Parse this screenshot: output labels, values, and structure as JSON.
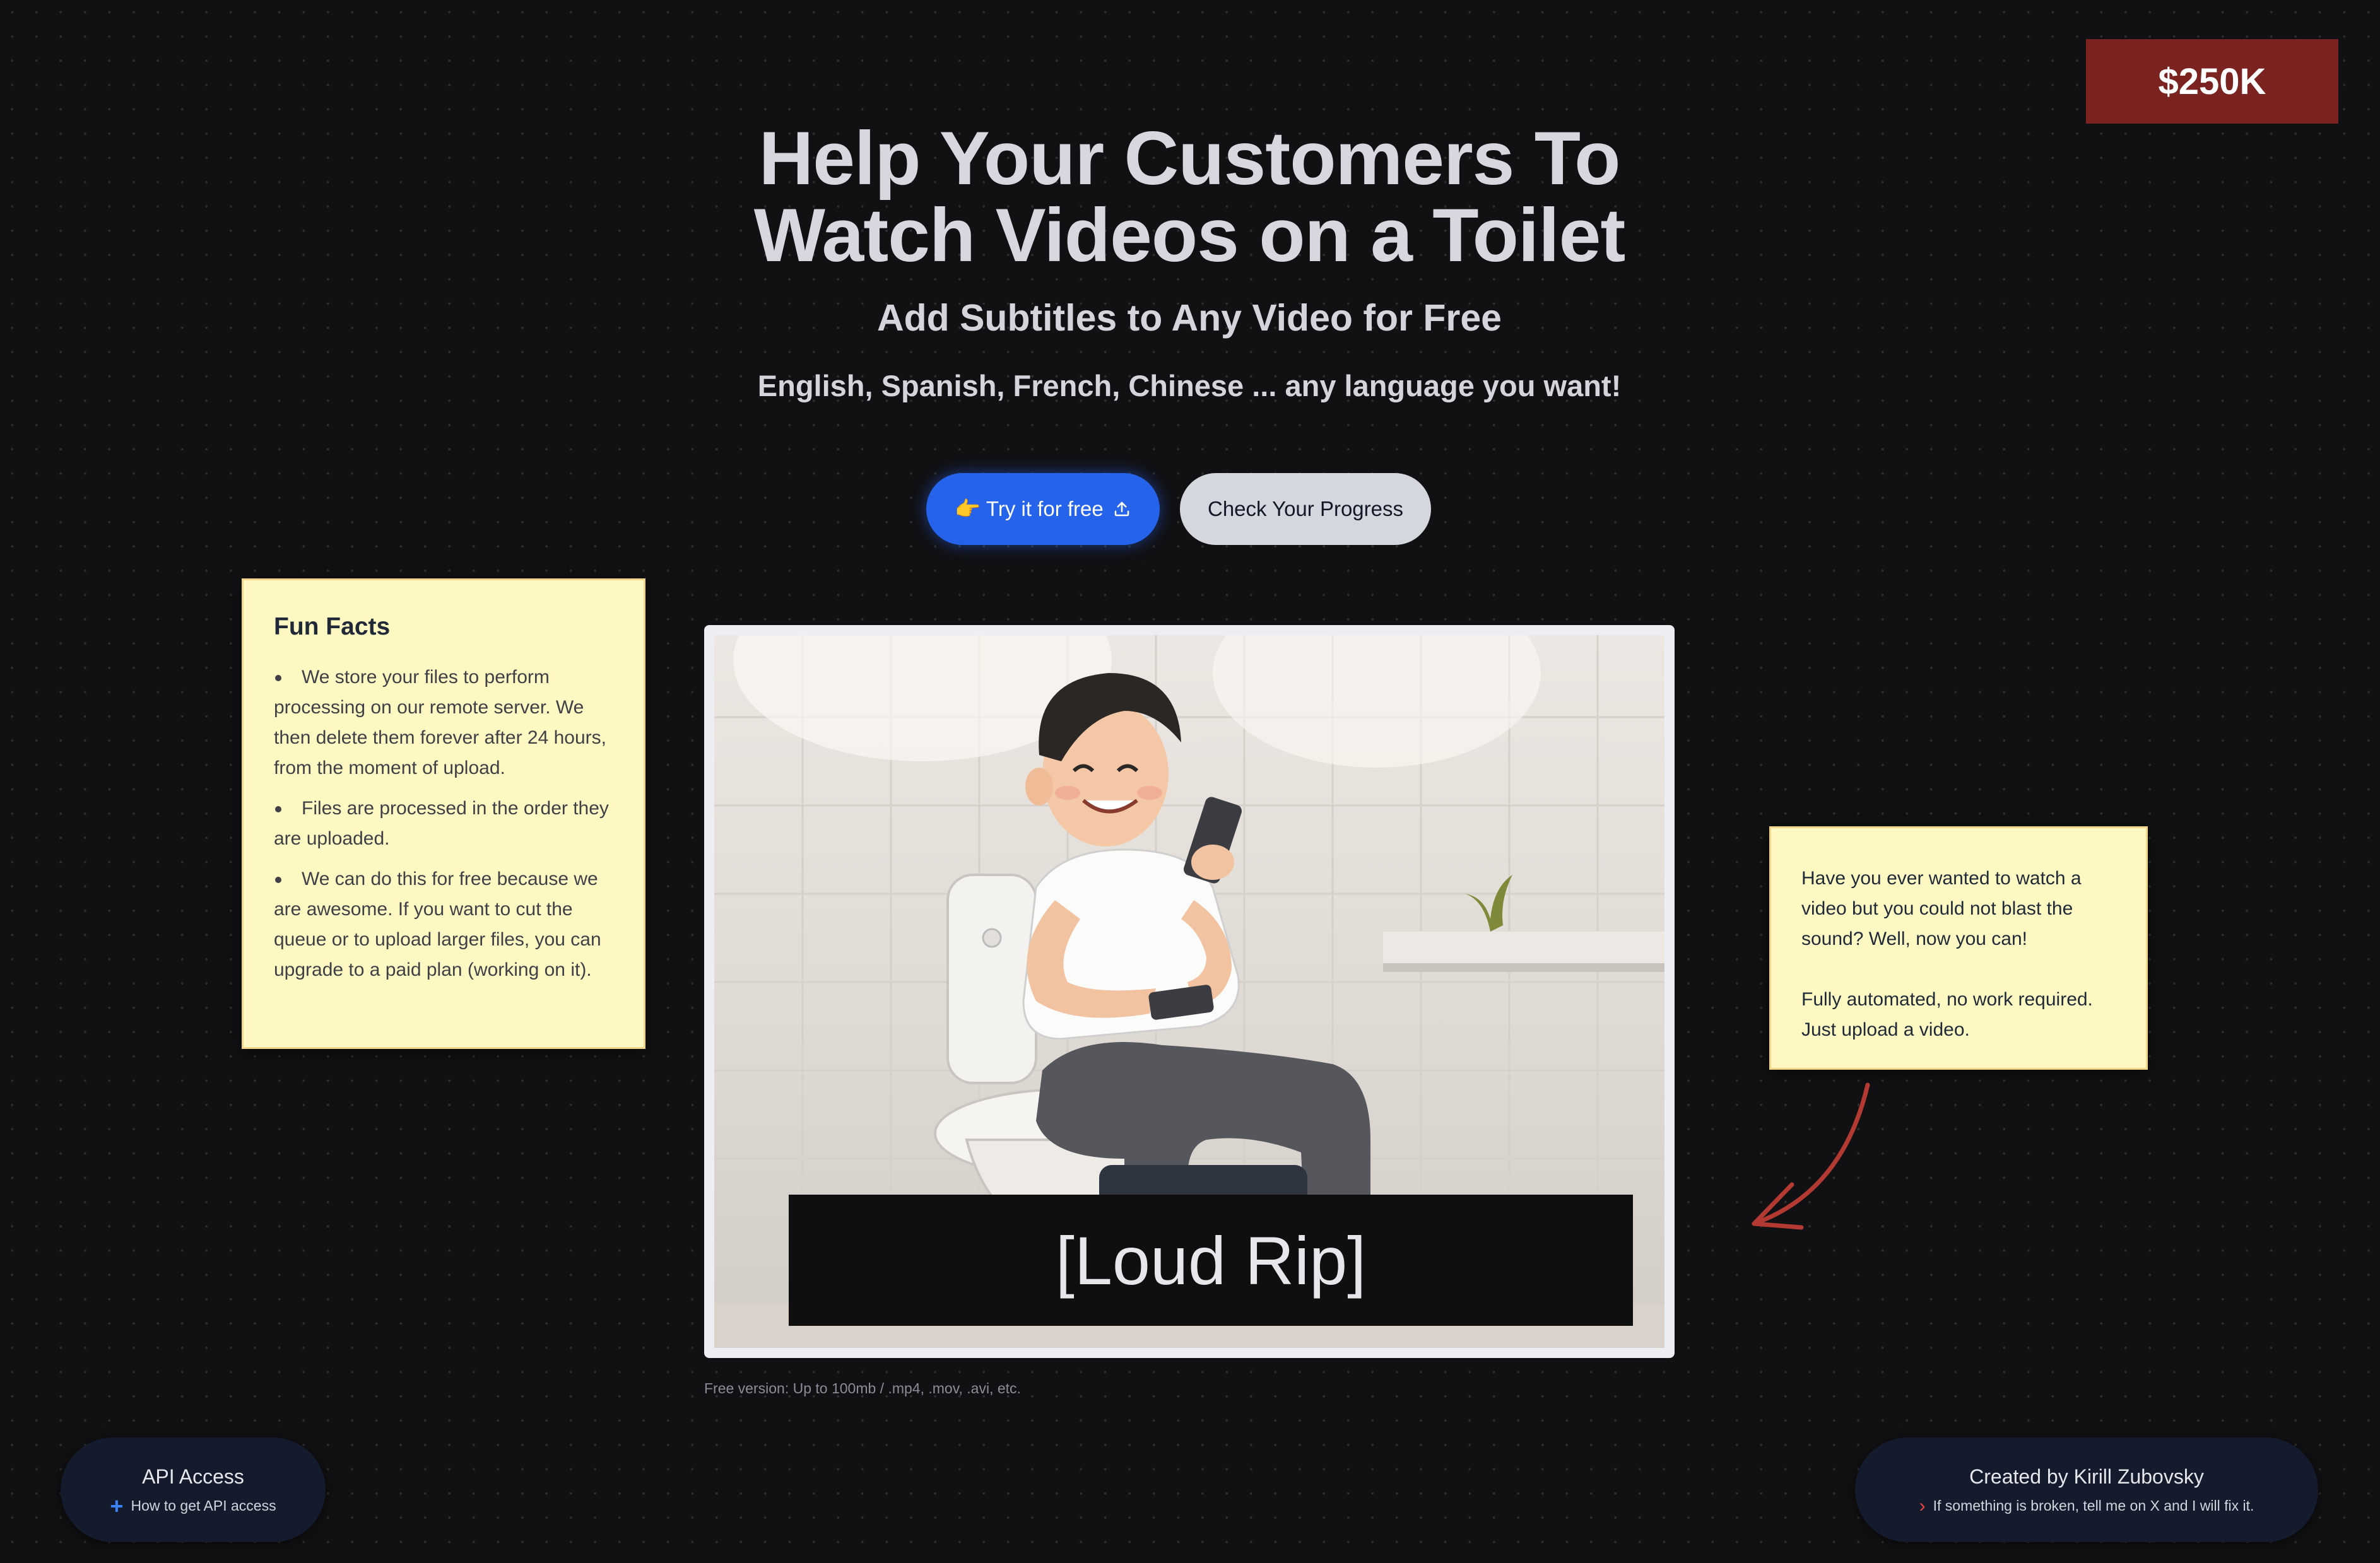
{
  "badge": {
    "label": "$250K"
  },
  "hero": {
    "title_line1": "Help Your Customers To",
    "title_line2": "Watch Videos on a Toilet",
    "subtitle": "Add Subtitles to Any Video for Free",
    "languages": "English, Spanish, French, Chinese ... any language you want!"
  },
  "actions": {
    "try_label": "👉 Try it for free",
    "try_icon": "upload-icon",
    "progress_label": "Check Your Progress"
  },
  "fun_facts": {
    "title": "Fun Facts",
    "items": [
      "We store your files to perform processing on our remote server. We then delete them forever after 24 hours, from the moment of upload.",
      "Files are processed in the order they are uploaded.",
      "We can do this for free because we are awesome. If you want to cut the queue or to upload larger files, you can upgrade to a paid plan (working on it)."
    ]
  },
  "callout": {
    "paragraph1": "Have you ever wanted to watch a video but you could not blast the sound? Well, now you can!",
    "paragraph2": "Fully automated, no work required. Just upload a video."
  },
  "video": {
    "caption": "[Loud Rip]",
    "limits_note": "Free version: Up to 100mb / .mp4, .mov, .avi, etc."
  },
  "footer": {
    "api_title": "API Access",
    "api_link": "How to get API access",
    "credit_title": "Created by Kirill Zubovsky",
    "credit_link": "If something is broken, tell me on X and I will fix it."
  },
  "colors": {
    "background": "#111012",
    "badge": "#7a2321",
    "primary": "#2563eb",
    "note": "#fef9c3",
    "arrow": "#b23a32"
  }
}
